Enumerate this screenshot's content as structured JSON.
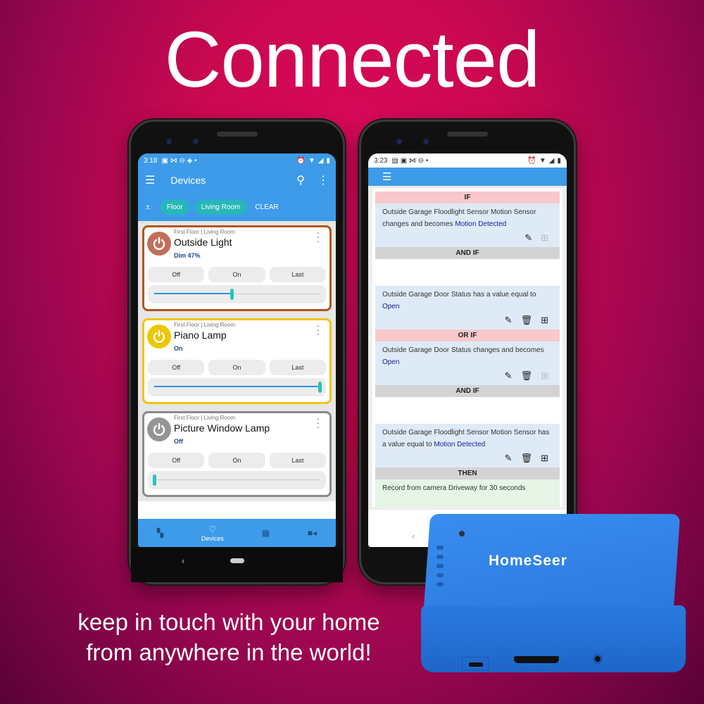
{
  "headline": "Connected",
  "tagline": {
    "line1": "keep in touch with your home",
    "line2": "from anywhere in the world!"
  },
  "colors": {
    "brand_blue": "#3d9be9",
    "chip_teal": "#28b7b9",
    "slider_thumb": "#28c6b6",
    "if_header": "#f8c8cb",
    "and_header": "#d3d3d3",
    "condition_bg": "#deeaf6",
    "then_bg": "#e6f5e6",
    "value_link": "#1a1aa0"
  },
  "phone1": {
    "status": {
      "time": "3:18",
      "icons": [
        "app-icon",
        "gmail-icon",
        "vpn-icon",
        "shield-icon",
        "dot-icon"
      ],
      "right_icons": [
        "alarm-icon",
        "wifi-icon",
        "signal-icon",
        "battery-icon"
      ]
    },
    "appbar": {
      "menu_icon": "hamburger-icon",
      "title": "Devices",
      "search_icon": "search-icon",
      "more_icon": "kebab-icon"
    },
    "filters": {
      "filter_icon": "filter-icon",
      "chips": [
        "Floor",
        "Living Room"
      ],
      "clear_label": "CLEAR"
    },
    "devices": [
      {
        "location": "First Floor | Living Room",
        "name": "Outside Light",
        "state": "Dim 47%",
        "level": 47,
        "border_color": "#b0561f",
        "icon_color": "#c0705a",
        "buttons": [
          "Off",
          "On",
          "Last"
        ]
      },
      {
        "location": "First Floor | Living Room",
        "name": "Piano Lamp",
        "state": "On",
        "level": 100,
        "border_color": "#f1c40f",
        "icon_color": "#eec700",
        "buttons": [
          "Off",
          "On",
          "Last"
        ]
      },
      {
        "location": "First Floor | Living Room",
        "name": "Picture Window Lamp",
        "state": "Off",
        "level": 0,
        "border_color": "#8a8a8a",
        "icon_color": "#959595",
        "buttons": [
          "Off",
          "On",
          "Last"
        ]
      }
    ],
    "bottom_nav": [
      {
        "icon": "dashboard-icon",
        "label": ""
      },
      {
        "icon": "lightbulb-icon",
        "label": "Devices",
        "active": true
      },
      {
        "icon": "calendar-icon",
        "label": ""
      },
      {
        "icon": "video-camera-icon",
        "label": ""
      }
    ]
  },
  "phone2": {
    "status": {
      "time": "3:23",
      "icons": [
        "news-icon",
        "app-icon",
        "gmail-icon",
        "vpn-icon",
        "dot-icon"
      ],
      "right_icons": [
        "alarm-icon",
        "wifi-icon",
        "signal-icon",
        "battery-icon"
      ]
    },
    "appbar": {
      "menu_icon": "hamburger-icon"
    },
    "rule": {
      "if_label": "IF",
      "cond1": {
        "text": "Outside Garage Floodlight Sensor Motion Sensor changes and becomes ",
        "value": "Motion Detected"
      },
      "and_if_1": "AND IF",
      "cond2": {
        "text": "Outside Garage Door Status has a value equal to ",
        "value": "Open"
      },
      "or_if": "OR IF",
      "cond3": {
        "text": "Outside Garage Door Status changes and becomes ",
        "value": "Open"
      },
      "and_if_2": "AND IF",
      "cond4": {
        "text": "Outside Garage Floodlight Sensor Motion Sensor has a value equal to ",
        "value": "Motion Detected"
      },
      "then_label": "THEN",
      "action1": "Record from camera Driveway for 30 seconds"
    }
  },
  "device": {
    "brand": "HomeSeer"
  }
}
